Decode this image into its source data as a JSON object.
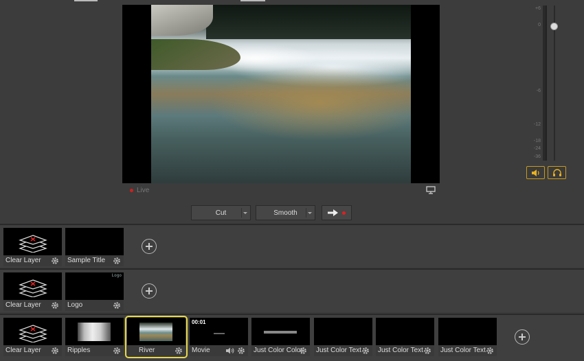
{
  "preview": {
    "live_label": "Live"
  },
  "transition": {
    "cut_label": "Cut",
    "smooth_label": "Smooth"
  },
  "meter": {
    "ticks": [
      "+6",
      "0",
      "-6",
      "-12",
      "-18",
      "-24",
      "-36"
    ]
  },
  "layers": [
    {
      "items": [
        {
          "label": "Clear Layer",
          "kind": "clear"
        },
        {
          "label": "Sample Title",
          "kind": "black"
        }
      ]
    },
    {
      "items": [
        {
          "label": "Clear Layer",
          "kind": "clear"
        },
        {
          "label": "Logo",
          "kind": "logo",
          "overlay_text": "Logo"
        }
      ]
    },
    {
      "items": [
        {
          "label": "Clear Layer",
          "kind": "clear"
        },
        {
          "label": "Ripples",
          "kind": "ripples"
        },
        {
          "label": "River",
          "kind": "river",
          "live": true,
          "selected": true
        },
        {
          "label": "Movie",
          "kind": "movie",
          "time": "00:01",
          "audio": true
        },
        {
          "label": "Just Color Color",
          "kind": "color-bar"
        },
        {
          "label": "Just Color Text",
          "kind": "black"
        },
        {
          "label": "Just Color Text",
          "kind": "black"
        },
        {
          "label": "Just Color Text",
          "kind": "black"
        }
      ]
    }
  ],
  "colors": {
    "accent": "#e8d84a",
    "live": "#e02020",
    "audio_border": "#c89a20"
  }
}
